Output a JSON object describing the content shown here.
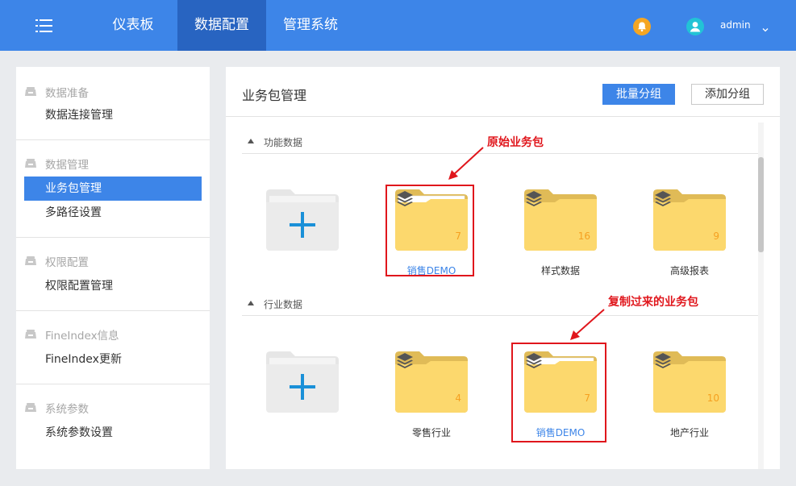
{
  "header": {
    "tabs": [
      {
        "label": "仪表板"
      },
      {
        "label": "数据配置"
      },
      {
        "label": "管理系统"
      }
    ],
    "active_tab": "数据配置",
    "username": "admin"
  },
  "sidebar": {
    "groups": [
      {
        "title": "数据准备",
        "items": [
          {
            "label": "数据连接管理"
          }
        ]
      },
      {
        "title": "数据管理",
        "items": [
          {
            "label": "业务包管理",
            "active": true
          },
          {
            "label": "多路径设置"
          }
        ]
      },
      {
        "title": "权限配置",
        "items": [
          {
            "label": "权限配置管理"
          }
        ]
      },
      {
        "title": "FineIndex信息",
        "items": [
          {
            "label": "FineIndex更新"
          }
        ]
      },
      {
        "title": "系统参数",
        "items": [
          {
            "label": "系统参数设置"
          }
        ]
      }
    ]
  },
  "main": {
    "title": "业务包管理",
    "batch_group_label": "批量分组",
    "add_group_label": "添加分组",
    "sections": [
      {
        "label": "功能数据",
        "packages": [
          {
            "name": "销售DEMO",
            "count": "7",
            "highlighted": true
          },
          {
            "name": "样式数据",
            "count": "16"
          },
          {
            "name": "高级报表",
            "count": "9"
          }
        ]
      },
      {
        "label": "行业数据",
        "packages": [
          {
            "name": "零售行业",
            "count": "4"
          },
          {
            "name": "销售DEMO",
            "count": "7",
            "highlighted": true
          },
          {
            "name": "地产行业",
            "count": "10"
          }
        ]
      }
    ]
  },
  "annotations": {
    "original": "原始业务包",
    "copied": "复制过来的业务包"
  },
  "colors": {
    "topbar": "#3d85e8",
    "active_tab": "#2864c1",
    "folder": "#fcd86d",
    "folder_tab": "#e0bb57",
    "count": "#f5a020",
    "annotation": "#e0161c",
    "bell": "#f5a623",
    "avatar": "#22c3d6"
  }
}
